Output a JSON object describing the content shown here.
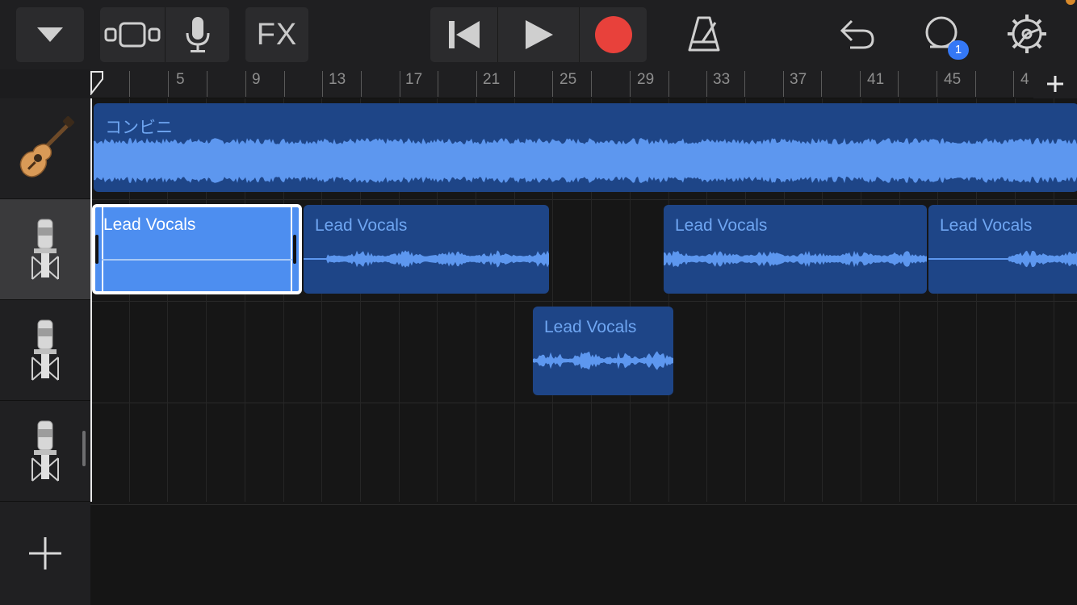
{
  "toolbar": {
    "browser_icon": "triangle-down-icon",
    "view_icon": "track-view-icon",
    "mic_icon": "microphone-icon",
    "fx_label": "FX",
    "rewind_icon": "skip-back-icon",
    "play_icon": "play-icon",
    "record_icon": "record-icon",
    "metronome_icon": "metronome-icon",
    "undo_icon": "undo-icon",
    "loop_icon": "loop-browser-icon",
    "loop_badge": "1",
    "settings_icon": "gear-icon",
    "record_color": "#e8413b"
  },
  "ruler": {
    "labels": [
      "5",
      "9",
      "13",
      "17",
      "21",
      "25",
      "29",
      "33",
      "37",
      "41",
      "45",
      "4"
    ],
    "add_icon": "plus-icon"
  },
  "tracks": [
    {
      "name": "guitar-track",
      "icon": "acoustic-guitar-icon"
    },
    {
      "name": "vocal-track-1",
      "icon": "condenser-mic-icon",
      "selected": true
    },
    {
      "name": "vocal-track-2",
      "icon": "condenser-mic-icon"
    },
    {
      "name": "vocal-track-3",
      "icon": "condenser-mic-icon"
    }
  ],
  "regions": {
    "guitar": {
      "label": "コンビニ"
    },
    "v1_selected": {
      "label": "Lead Vocals"
    },
    "v1_b": {
      "label": "Lead Vocals"
    },
    "v1_c": {
      "label": "Lead Vocals"
    },
    "v1_d": {
      "label": "Lead Vocals"
    },
    "v2_a": {
      "label": "Lead Vocals"
    }
  },
  "add_track_icon": "plus-icon",
  "colors": {
    "region_fill": "#1e4587",
    "waveform": "#5d97ef",
    "selected_region": "#4d8ef0",
    "badge": "#3478f6"
  }
}
